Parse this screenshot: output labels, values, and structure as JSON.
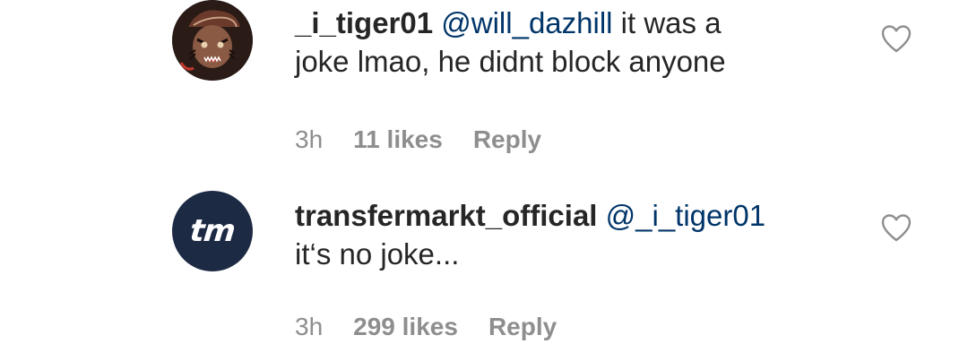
{
  "comments": [
    {
      "avatar_icon": "tiger-avatar-icon",
      "username": "_i_tiger01",
      "mention": "@will_dazhill",
      "text_line1": " it was a",
      "text_line2": "joke lmao, he didnt block anyone",
      "time": "3h",
      "likes": "11 likes",
      "reply": "Reply",
      "like_icon": "heart-outline-icon"
    },
    {
      "avatar_icon": "transfermarkt-logo-icon",
      "avatar_text": "tm",
      "username": "transfermarkt_official",
      "mention": "@_i_tiger01",
      "text_line2": "it‘s no joke...",
      "time": "3h",
      "likes": "299 likes",
      "reply": "Reply",
      "like_icon": "heart-outline-icon"
    }
  ],
  "colors": {
    "text": "#262626",
    "mention": "#003569",
    "meta": "#8e8e8e",
    "tm_avatar_bg": "#1d2a44"
  }
}
